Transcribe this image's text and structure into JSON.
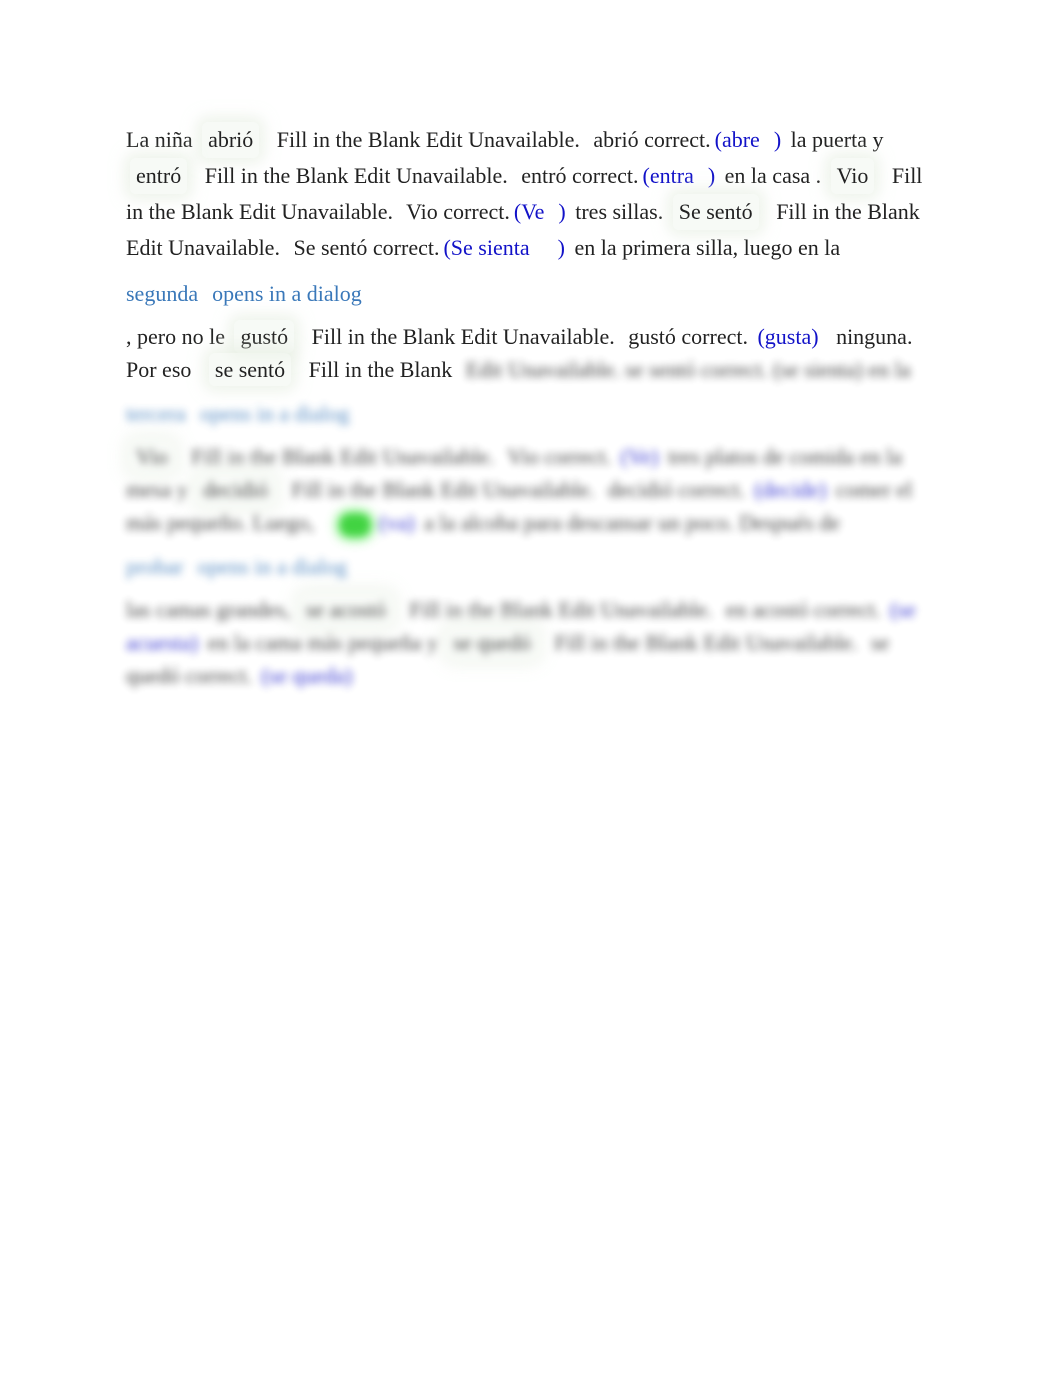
{
  "colors": {
    "text": "#222222",
    "answer": "#1212c8",
    "link": "#3a78b9",
    "badge": "#22cc22"
  },
  "fill_label": "Fill in the Blank Edit Unavailable.",
  "correct_label": "correct.",
  "dialog_label": "opens in a dialog",
  "p1": {
    "t1": "La niña",
    "b1": "abrió",
    "r1": "abrió",
    "a1o": "(",
    "a1": "abre",
    "a1c": ")",
    "t2": "la puerta y",
    "b2": "entró",
    "r2": "entró",
    "a2o": "(",
    "a2": "entra",
    "a2c": ")",
    "t3": "en la casa .",
    "b3": "Vio",
    "r3": "Vio",
    "a3o": "(",
    "a3": "Ve",
    "a3c": ")",
    "t4": "tres sillas.",
    "b4": "Se sentó",
    "r4": "Se sentó",
    "a4o": "(",
    "a4": "Se sienta",
    "a4c": ")",
    "t5": "en la primera silla, luego en la"
  },
  "link1": "segunda",
  "p2": {
    "t1": ", pero no le",
    "b1": "gustó",
    "r1": "gustó",
    "a1": "(gusta)",
    "t2": "ninguna. Por eso",
    "b2": "se sentó",
    "t3": "Fill in the Blank",
    "rest": "Edit Unavailable. se sentó correct. (se sienta) en la"
  },
  "link2": "tercera",
  "p3": {
    "b1": "Vio",
    "r1": "Vio correct.",
    "a1": "(Ve)",
    "t1": "tres platos de comida en la mesa y",
    "b2": "decidió",
    "r2": "decidió correct.",
    "a2": "(decide)",
    "t2": "comer el más pequeño. Luego,",
    "a3": "(va)",
    "t3": "a la alcoba para descansar un poco. Después de"
  },
  "link3": "probar",
  "p4": {
    "t1": "las camas grandes,",
    "b1": "se acostó",
    "t2": "en",
    "r1": "acostó correct.",
    "a1": "(se acuesta)",
    "t3": "en la cama más pequeña y",
    "b2": "se quedó",
    "r2": "se quedó correct.",
    "a2": "(se queda)"
  }
}
